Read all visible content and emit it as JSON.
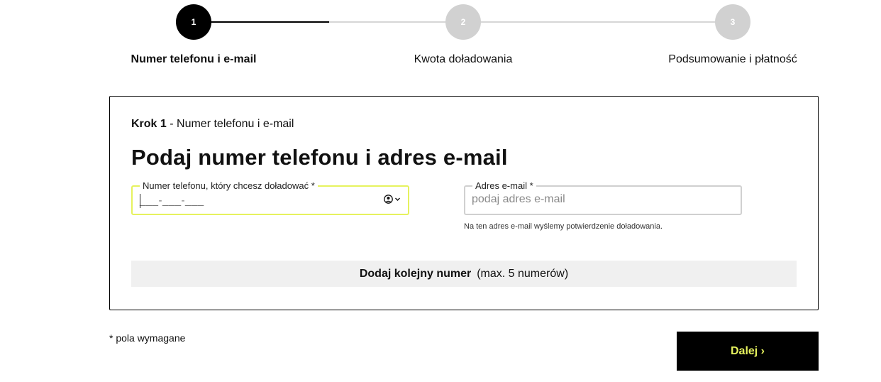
{
  "stepper": {
    "steps": [
      {
        "number": "1",
        "label": "Numer telefonu i e-mail",
        "state": "active"
      },
      {
        "number": "2",
        "label": "Kwota doładowania",
        "state": "inactive"
      },
      {
        "number": "3",
        "label": "Podsumowanie i płatność",
        "state": "inactive"
      }
    ]
  },
  "form": {
    "crumb_bold": "Krok 1",
    "crumb_rest": " - Numer telefonu i e-mail",
    "heading": "Podaj numer telefonu i adres e-mail",
    "phone": {
      "label": "Numer telefonu, który chcesz doładować *",
      "mask": "___-___-___"
    },
    "email": {
      "label": "Adres e-mail *",
      "placeholder": "podaj adres e-mail",
      "hint": "Na ten adres e-mail wyślemy potwierdzenie doładowania."
    },
    "add_number_bold": "Dodaj kolejny numer",
    "add_number_note": "(max. 5 numerów)"
  },
  "footer": {
    "required_note": "* pola wymagane",
    "next_label": "Dalej ›"
  },
  "colors": {
    "accent": "#e6f25e",
    "active_step": "#000000",
    "inactive_step": "#d1d1d1"
  }
}
